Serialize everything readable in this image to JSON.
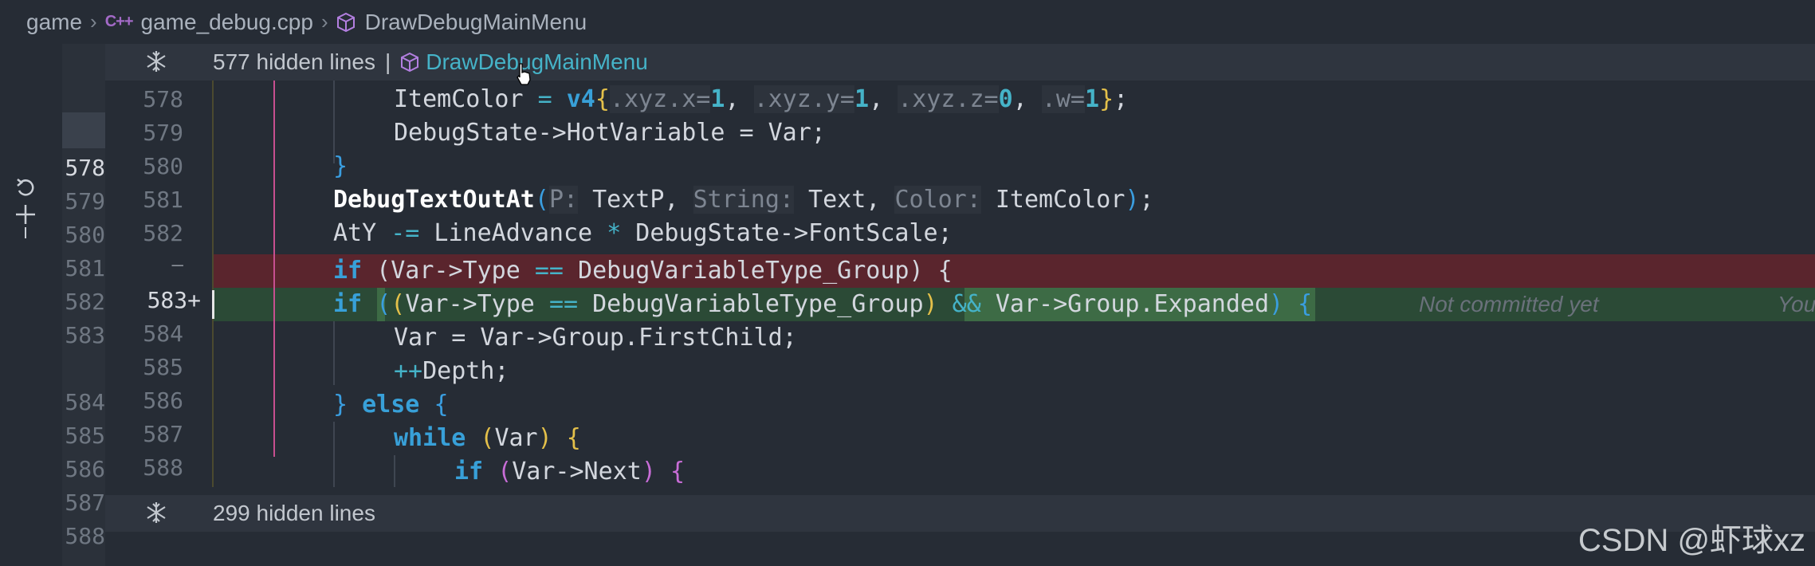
{
  "breadcrumb": {
    "folder": "game",
    "file_badge": "C++",
    "file": "game_debug.cpp",
    "symbol": "DrawDebugMainMenu"
  },
  "folds": {
    "top_count": "577 hidden lines",
    "top_separator": "|",
    "top_symbol": "DrawDebugMainMenu",
    "bottom_count": "299 hidden lines"
  },
  "old_line_numbers": [
    "578",
    "579",
    "580",
    "581",
    "582",
    "583",
    "584",
    "585",
    "586",
    "587",
    "588"
  ],
  "new_line_numbers": [
    "578",
    "579",
    "580",
    "581",
    "582",
    "583+",
    "584",
    "585",
    "586",
    "587",
    "588"
  ],
  "deleted_marker": "—",
  "code": {
    "l578": {
      "a": "ItemColor ",
      "eq": "=",
      "sp": " ",
      "v4": "v4",
      "ob": "{",
      "x": ".xyz.x=",
      "n1": "1",
      "c1": ", ",
      "yy": ".xyz.y=",
      "n2": "1",
      "c2": ", ",
      "z": ".xyz.z=",
      "n3": "0",
      "c3": ", ",
      "w": ".w=",
      "n4": "1",
      "cb": "}",
      "end": ";"
    },
    "l579": "DebugState->HotVariable = Var;",
    "l580": "}",
    "l581": {
      "fn": "DebugTextOutAt",
      "op": "(",
      "h1": "P:",
      "a1": " TextP, ",
      "h2": "String:",
      "a2": " Text, ",
      "h3": "Color:",
      "a3": " ItemColor",
      "cl": ")",
      "end": ";"
    },
    "l582": {
      "a": "AtY ",
      "op1": "-=",
      "b": " LineAdvance ",
      "op2": "*",
      "c": " DebugState->FontScale;"
    },
    "del": {
      "kw": "if",
      "a": " (Var->Type ",
      "eq": "==",
      "b": " DebugVariableType_Group) {"
    },
    "add": {
      "kw": "if",
      "sp": " ",
      "o1": "(",
      "o2": "(",
      "a": "Var->Type ",
      "eq": "==",
      "b": " DebugVariableType_Group",
      "c1": ")",
      "sp2": " ",
      "and": "&&",
      "c": " Var->Group.Expanded",
      "c2": ")",
      "d": " ",
      "ob": "{"
    },
    "l584": "Var = Var->Group.FirstChild;",
    "l585": {
      "op": "++",
      "a": "Depth;"
    },
    "l586": {
      "cb": "}",
      "a": " ",
      "kw": "else",
      "b": " ",
      "ob": "{"
    },
    "l587": {
      "kw": "while",
      "a": " ",
      "o": "(",
      "v": "Var",
      "c": ")",
      "b": " ",
      "ob": "{"
    },
    "l588": {
      "kw": "if",
      "a": " ",
      "o": "(",
      "v": "Var->Next",
      "c": ")",
      "b": " ",
      "ob": "{"
    }
  },
  "blame": {
    "message": "Not committed yet",
    "author": "You"
  },
  "watermark": "CSDN @虾球xz",
  "colors": {
    "deleted_bg": "#5a252d",
    "added_bg": "#2b4a36",
    "keyword": "#38a0d8",
    "accent": "#45b3c8"
  }
}
